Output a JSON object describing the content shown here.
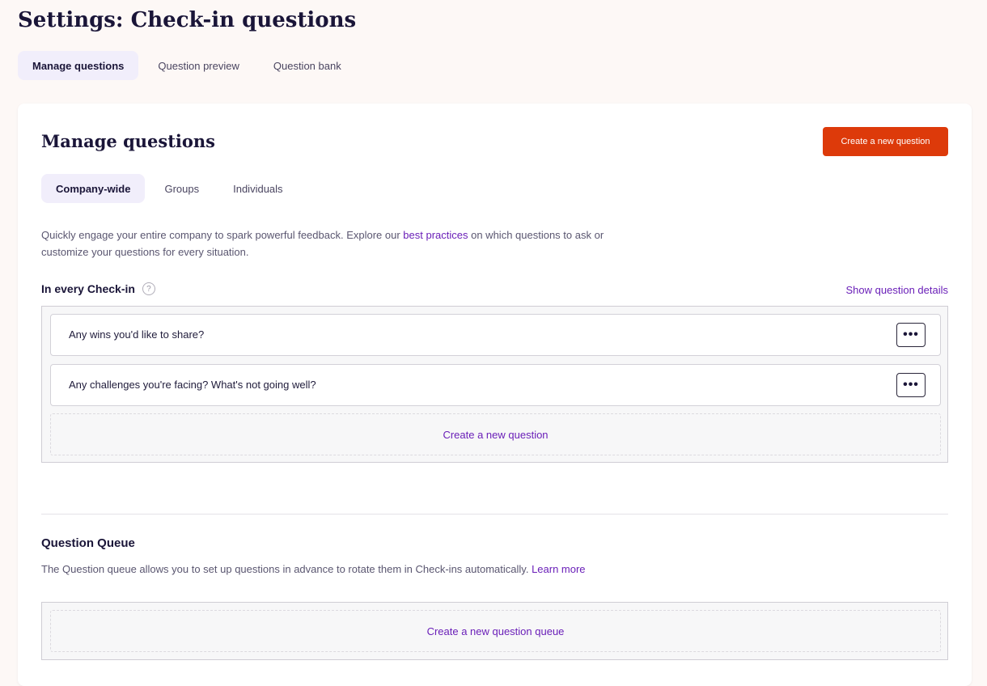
{
  "page": {
    "title": "Settings: Check-in questions"
  },
  "top_tabs": [
    {
      "label": "Manage questions",
      "active": true
    },
    {
      "label": "Question preview",
      "active": false
    },
    {
      "label": "Question bank",
      "active": false
    }
  ],
  "manage": {
    "title": "Manage questions",
    "create_button_label": "Create a new question",
    "sub_tabs": [
      {
        "label": "Company-wide",
        "active": true
      },
      {
        "label": "Groups",
        "active": false
      },
      {
        "label": "Individuals",
        "active": false
      }
    ],
    "intro_before": "Quickly engage your entire company to spark powerful feedback. Explore our ",
    "intro_link": "best practices",
    "intro_after": " on which questions to ask or customize your questions for every situation."
  },
  "every_checkin": {
    "label": "In every Check-in",
    "help_icon": "?",
    "details_link": "Show question details",
    "questions": [
      {
        "text": "Any wins you'd like to share?",
        "menu_icon": "•••"
      },
      {
        "text": "Any challenges you're facing? What's not going well?",
        "menu_icon": "•••"
      }
    ],
    "add_label": "Create a new question"
  },
  "queue": {
    "title": "Question Queue",
    "description": "The Question queue allows you to set up questions in advance to rotate them in Check-ins automatically.",
    "learn_more": "Learn more",
    "add_label": "Create a new question queue"
  },
  "colors": {
    "accent": "#dd3a0a",
    "link": "#6a1fb8",
    "active_tab_bg": "#f1eefb",
    "page_bg": "#fdf8f6"
  }
}
